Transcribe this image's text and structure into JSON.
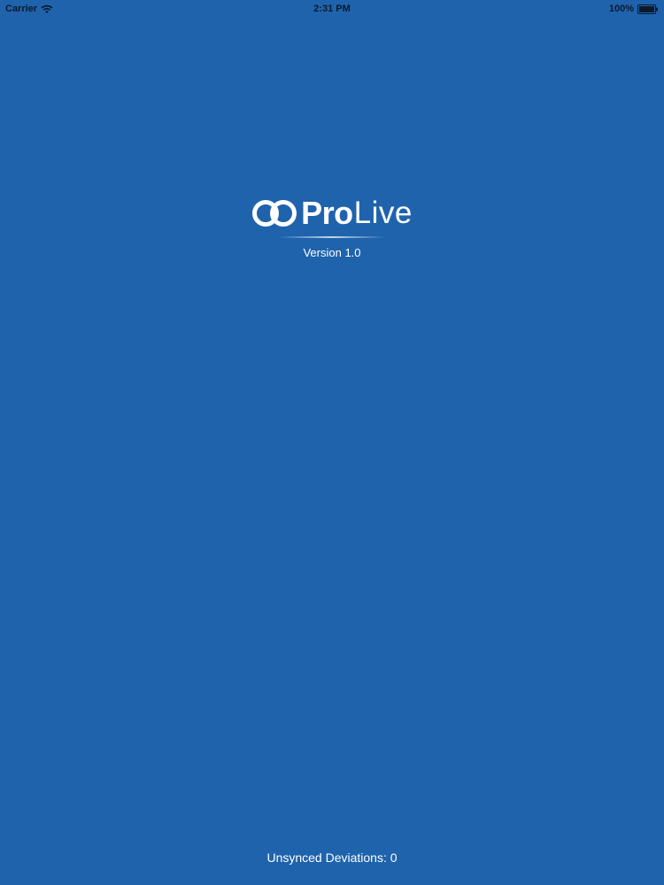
{
  "status_bar": {
    "carrier": "Carrier",
    "time": "2:31 PM",
    "battery": "100%",
    "wifi_icon": "wifi-icon",
    "battery_icon": "battery-icon"
  },
  "logo": {
    "pro_text": "Pro",
    "live_text": "Live",
    "rings_icon": "two-rings-logo-icon"
  },
  "version_text": "Version 1.0",
  "footer": {
    "unsynced_text": "Unsynced Deviations: 0"
  },
  "colors": {
    "background": "#1f63ad",
    "text": "#ffffff",
    "status_text": "#0c1a2c"
  }
}
